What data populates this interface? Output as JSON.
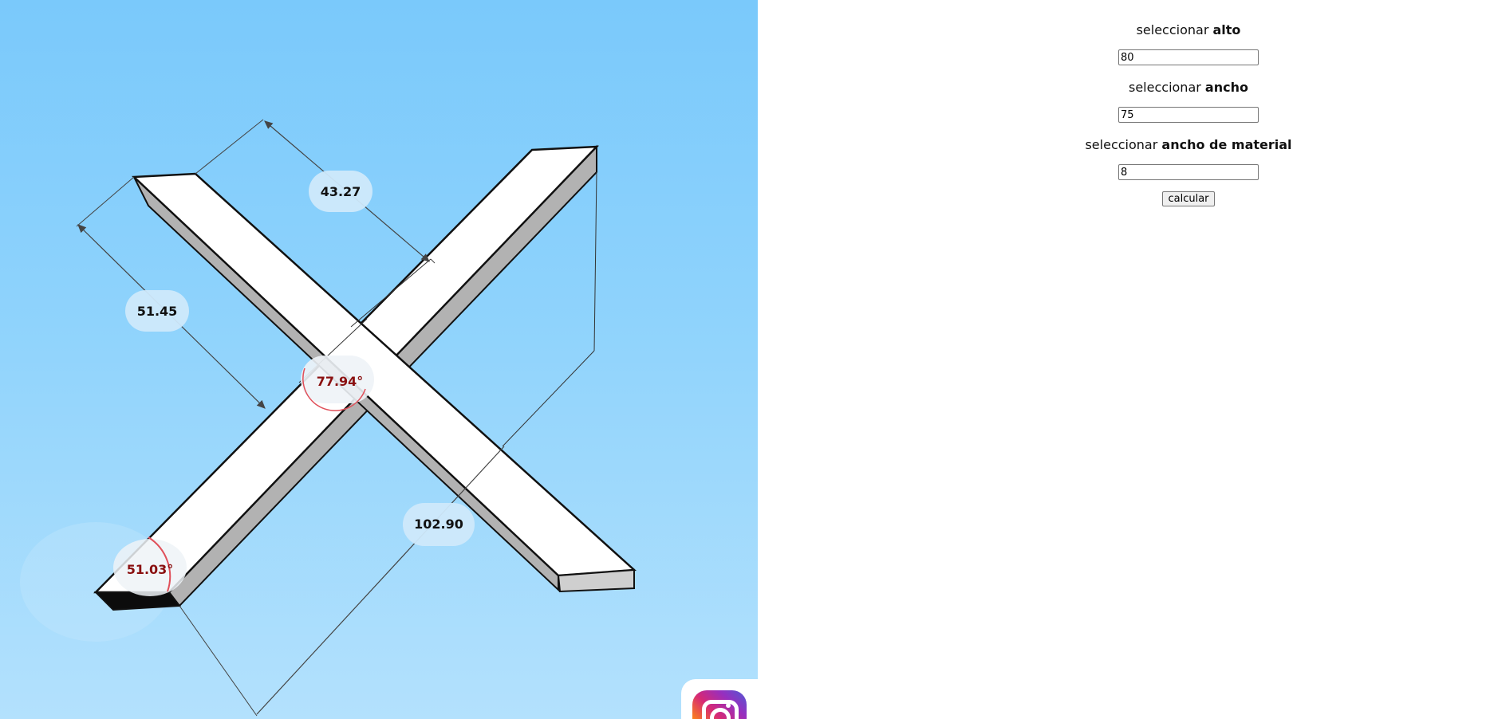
{
  "viewer": {
    "dimensions": {
      "top": "43.27",
      "left": "51.45",
      "bottom": "102.90"
    },
    "angles": {
      "center": "77.94°",
      "corner": "51.03°"
    },
    "colors": {
      "sky_top": "#7ac9fb",
      "sky_bottom": "#b3e1fd",
      "angle_arc": "#e0505a",
      "angle_text": "#8a1010"
    }
  },
  "controls": {
    "alto": {
      "prefix": "seleccionar",
      "bold": "alto",
      "value": "80"
    },
    "ancho": {
      "prefix": "seleccionar",
      "bold": "ancho",
      "value": "75"
    },
    "material": {
      "prefix": "seleccionar",
      "bold": "ancho de material",
      "value": "8"
    },
    "button_label": "calcular"
  },
  "social": {
    "icon": "instagram-icon"
  }
}
